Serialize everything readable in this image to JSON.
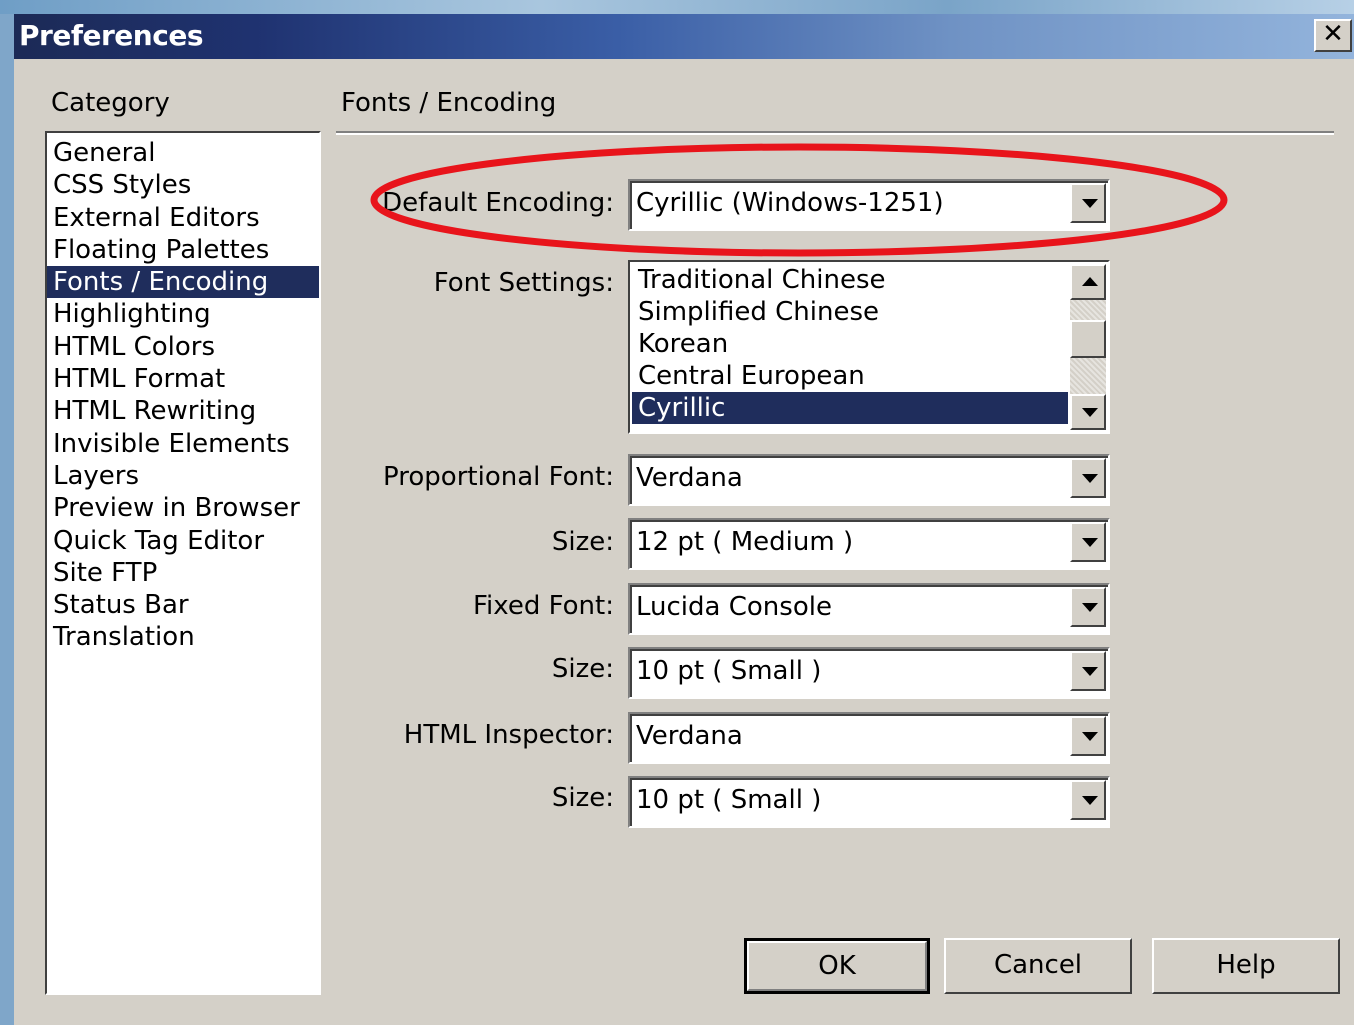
{
  "window": {
    "title": "Preferences",
    "close_glyph": "✕"
  },
  "category": {
    "label": "Category",
    "items": [
      {
        "label": "General",
        "selected": false
      },
      {
        "label": "CSS Styles",
        "selected": false
      },
      {
        "label": "External Editors",
        "selected": false
      },
      {
        "label": "Floating Palettes",
        "selected": false
      },
      {
        "label": "Fonts / Encoding",
        "selected": true
      },
      {
        "label": "Highlighting",
        "selected": false
      },
      {
        "label": "HTML Colors",
        "selected": false
      },
      {
        "label": "HTML Format",
        "selected": false
      },
      {
        "label": "HTML Rewriting",
        "selected": false
      },
      {
        "label": "Invisible Elements",
        "selected": false
      },
      {
        "label": "Layers",
        "selected": false
      },
      {
        "label": "Preview in Browser",
        "selected": false
      },
      {
        "label": "Quick Tag Editor",
        "selected": false
      },
      {
        "label": "Site FTP",
        "selected": false
      },
      {
        "label": "Status Bar",
        "selected": false
      },
      {
        "label": "Translation",
        "selected": false
      }
    ]
  },
  "section": {
    "title": "Fonts / Encoding"
  },
  "fields": {
    "default_encoding": {
      "label": "Default Encoding:",
      "value": "Cyrillic (Windows-1251)"
    },
    "font_settings": {
      "label": "Font Settings:",
      "items": [
        "Traditional Chinese",
        "Simplified Chinese",
        "Korean",
        "Central European",
        "Cyrillic"
      ],
      "selected": "Cyrillic"
    },
    "proportional_font": {
      "label": "Proportional Font:",
      "value": "Verdana"
    },
    "proportional_size": {
      "label": "Size:",
      "value": "12 pt  ( Medium )"
    },
    "fixed_font": {
      "label": "Fixed Font:",
      "value": "Lucida Console"
    },
    "fixed_size": {
      "label": "Size:",
      "value": "10 pt  ( Small )"
    },
    "html_inspector": {
      "label": "HTML Inspector:",
      "value": "Verdana"
    },
    "inspector_size": {
      "label": "Size:",
      "value": "10 pt  ( Small )"
    }
  },
  "buttons": {
    "ok": "OK",
    "cancel": "Cancel",
    "help": "Help"
  },
  "annotation": {
    "color": "#e8141b"
  },
  "colors": {
    "selection": "#1f2d5c",
    "dialog_bg": "#d4d0c8"
  }
}
